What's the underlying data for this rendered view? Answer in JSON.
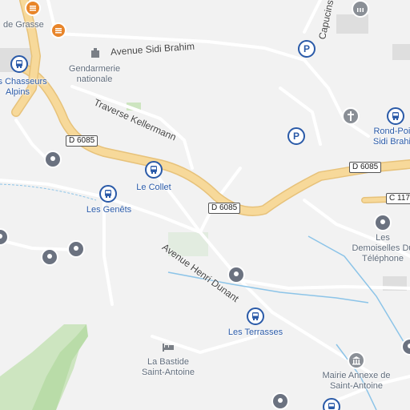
{
  "map": {
    "road_shields": [
      "D 6085",
      "D 6085",
      "D 6085",
      "C 117"
    ],
    "streets": [
      "Avenue Sidi Brahim",
      "Traverse Kellermann",
      "Avenue Henri Dunant",
      "Capucins"
    ],
    "places": {
      "grasse": "de Grasse",
      "gendarmerie": "Gendarmerie nationale",
      "chasseurs": "Les Chasseurs Alpins",
      "rondpoint": "Rond-Point Sidi Brahim",
      "collet": "Le Collet",
      "genets": "Les Genêts",
      "demoiselles": "Les Demoiselles Du Téléphone",
      "terrasses": "Les Terrasses",
      "bastide": "La Bastide Saint-Antoine",
      "mairie": "Mairie Annexe de Saint-Antoine"
    },
    "parking_label": "P",
    "icons": [
      "bus-stop-icon",
      "parking-icon",
      "poi-pin-icon",
      "restaurant-icon",
      "church-icon",
      "town-hall-icon",
      "hotel-icon",
      "police-icon"
    ],
    "colors": {
      "background": "#f2f2f2",
      "main_road": "#f7d99a",
      "road_casing": "#e7c27a",
      "water": "#8cc4e8",
      "park": "#cde5c0",
      "transit": "#2a5aa8"
    }
  }
}
